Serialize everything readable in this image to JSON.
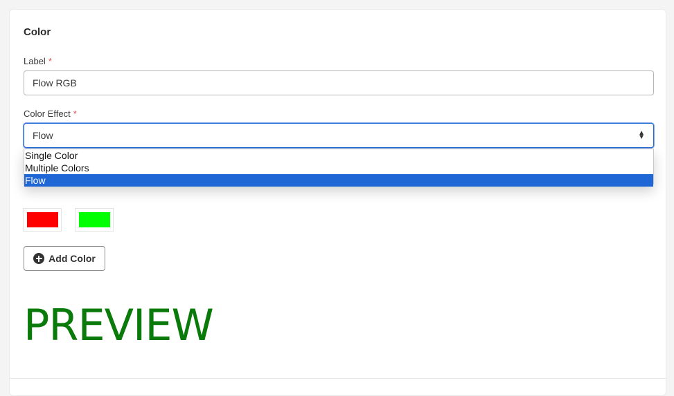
{
  "section": {
    "title": "Color"
  },
  "label_field": {
    "label": "Label",
    "required_mark": "*",
    "value": "Flow RGB"
  },
  "effect_field": {
    "label": "Color Effect",
    "required_mark": "*",
    "selected": "Flow",
    "options": [
      "Single Color",
      "Multiple Colors",
      "Flow"
    ]
  },
  "colors": [
    {
      "hex": "#ff0000"
    },
    {
      "hex": "#00ff00"
    }
  ],
  "add_color_button": {
    "label": "Add Color",
    "icon": "plus-circle-icon"
  },
  "preview": {
    "text": "PREVIEW",
    "color": "#0a7a0a"
  },
  "theme": {
    "accent": "#1e67d4",
    "required": "#d9534f"
  }
}
